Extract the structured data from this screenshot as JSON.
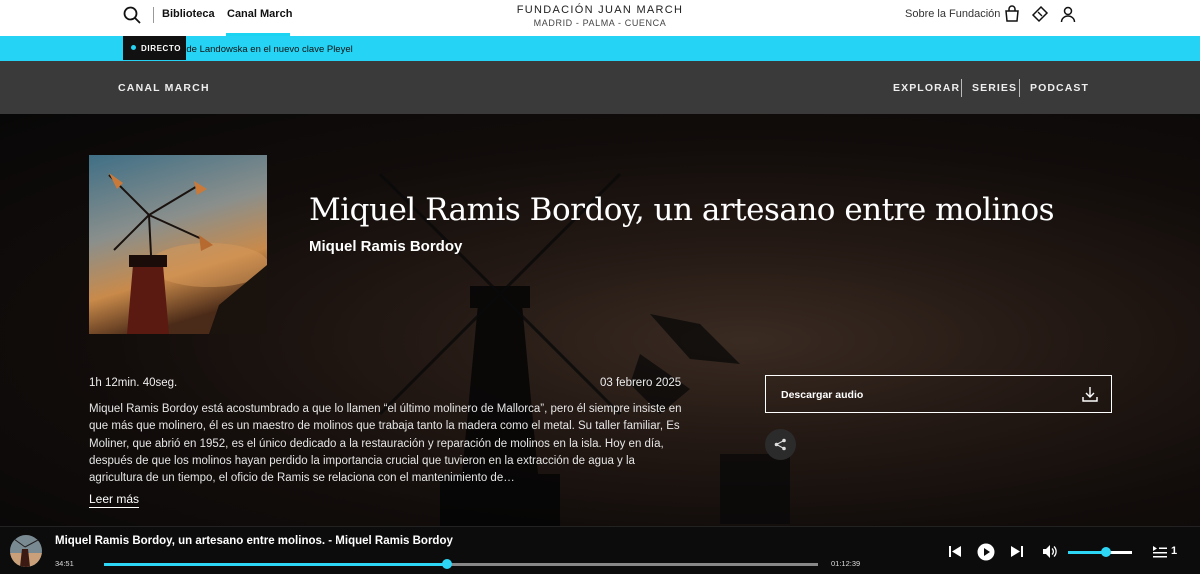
{
  "topbar": {
    "nav": [
      {
        "label": "Biblioteca"
      },
      {
        "label": "Canal March"
      }
    ],
    "logo_line1": "FUNDACIÓN JUAN MARCH",
    "logo_line2": "MADRID - PALMA - CUENCA",
    "about_label": "Sobre la Fundación",
    "icons": [
      "search-icon",
      "shopping-bag-icon",
      "ticket-icon",
      "user-icon"
    ]
  },
  "live": {
    "badge": "DIRECTO",
    "ticker_italic": "erg",
    "ticker_rest": " de Landowska en el nuevo clave Pleyel",
    "accent": "#25d4f5"
  },
  "canal": {
    "brand": "CANAL MARCH",
    "links": [
      {
        "label": "EXPLORAR"
      },
      {
        "label": "SERIES"
      },
      {
        "label": "PODCAST"
      }
    ]
  },
  "episode": {
    "title": "Miquel Ramis Bordoy, un artesano entre molinos",
    "author": "Miquel Ramis Bordoy",
    "duration": "1h 12min. 40seg.",
    "date": "03 febrero 2025",
    "description": "Miquel Ramis Bordoy está acostumbrado a que lo llamen “el último molinero de Mallorca”, pero él siempre insiste en que más que molinero, él es un maestro de molinos que trabaja tanto la madera como el metal. Su taller familiar, Es Moliner, que abrió en 1952, es el único dedicado a la restauración y reparación de molinos en la isla. Hoy en día, después de que los molinos hayan perdido la importancia crucial que tuvieron en la extracción de agua y la agricultura de un tiempo, el oficio de Ramis se relaciona con el mantenimiento de…",
    "read_more": "Leer más",
    "download_label": "Descargar audio"
  },
  "player": {
    "now_playing": "Miquel Ramis Bordoy, un artesano entre molinos. - Miquel Ramis Bordoy",
    "current_time": "34:51",
    "total_time": "01:12:39",
    "progress": 0.48,
    "volume": 0.6,
    "queue_count": "1",
    "accent": "#2ed6f6"
  }
}
